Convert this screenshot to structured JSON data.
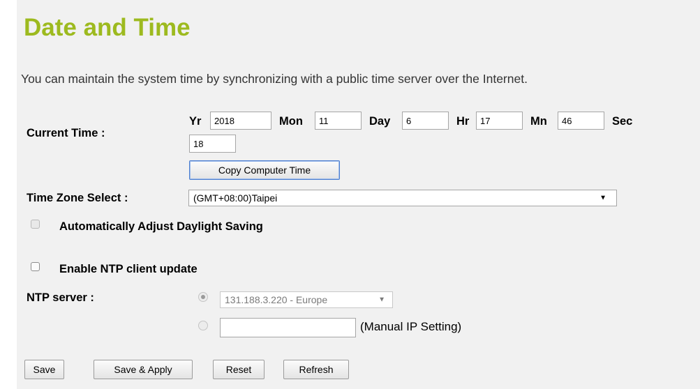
{
  "page": {
    "title": "Date and Time",
    "description": "You can maintain the system time by synchronizing with a public time server over the Internet."
  },
  "current_time": {
    "label": "Current Time :",
    "year_label": "Yr",
    "year": "2018",
    "month_label": "Mon",
    "month": "11",
    "day_label": "Day",
    "day": "6",
    "hour_label": "Hr",
    "hour": "17",
    "minute_label": "Mn",
    "minute": "46",
    "second_label": "Sec",
    "second": "18",
    "copy_button": "Copy Computer Time"
  },
  "timezone": {
    "label": "Time Zone Select :",
    "selected": "(GMT+08:00)Taipei"
  },
  "daylight": {
    "label": "Automatically Adjust Daylight Saving",
    "checked": false,
    "disabled": true
  },
  "ntp": {
    "enable_label": "Enable NTP client update",
    "enable_checked": false,
    "server_label": "NTP server :",
    "server_selected": "131.188.3.220 - Europe",
    "manual_ip_value": "",
    "manual_ip_label": "(Manual IP Setting)"
  },
  "buttons": {
    "save": "Save",
    "save_apply": "Save & Apply",
    "reset": "Reset",
    "refresh": "Refresh"
  },
  "colors": {
    "title": "#9dba1f",
    "panel_background": "#f1f1f1"
  },
  "icons": {
    "select_caret": "caret-down-icon"
  }
}
